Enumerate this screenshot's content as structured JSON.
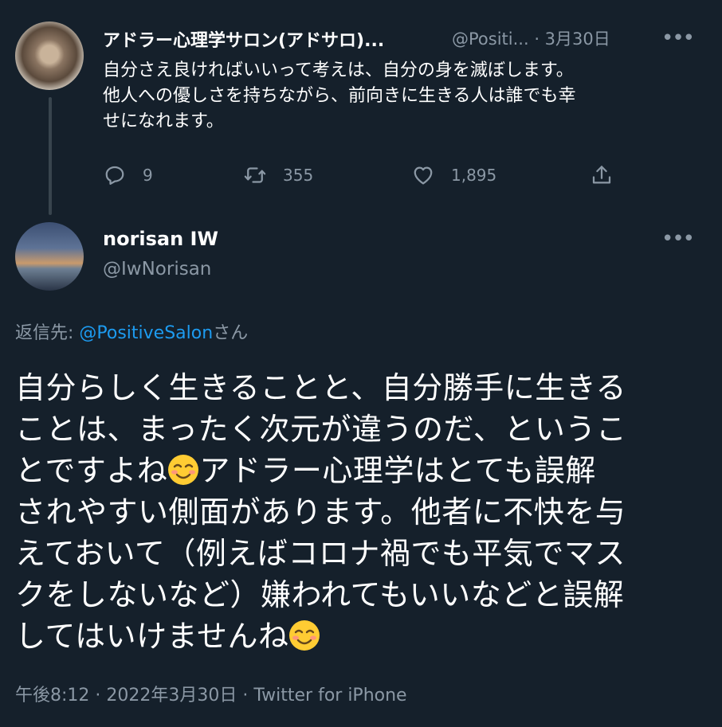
{
  "original_tweet": {
    "name": "アドラー心理学サロン(アドサロ)...",
    "handle": "@Positi...",
    "date": "· 3月30日",
    "more_icon": "ellipsis-icon",
    "text_lines": [
      "自分さえ良ければいいって考えは、自分の身を滅ぼします。",
      "他人への優しさを持ちながら、前向きに生きる人は誰でも幸",
      "せになれます。"
    ],
    "actions": {
      "reply_count": "9",
      "retweet_count": "355",
      "like_count": "1,895"
    }
  },
  "reply_tweet": {
    "name": "norisan IW",
    "handle": "@IwNorisan",
    "replying_to_label": "返信先: ",
    "replying_to_link": "@PositiveSalon",
    "replying_to_suffix": "さん",
    "text_segments": {
      "line1": "自分らしく生きることと、自分勝手に生きる",
      "line2": "ことは、まったく次元が違うのだ、というこ",
      "line3a": "とですよね",
      "line3b": "アドラー心理学はとても誤解",
      "line4": "されやすい側面があります。他者に不快を与",
      "line5": "えておいて（例えばコロナ禍でも平気でマス",
      "line6": "クをしないなど）嫌われてもいいなどと誤解",
      "line7a": "してはいけませんね"
    },
    "meta": "午後8:12 · 2022年3月30日 · Twitter for iPhone"
  },
  "colors": {
    "background": "#15202b",
    "text": "#ffffff",
    "secondary": "#8b98a5",
    "link": "#1d9bf0"
  }
}
